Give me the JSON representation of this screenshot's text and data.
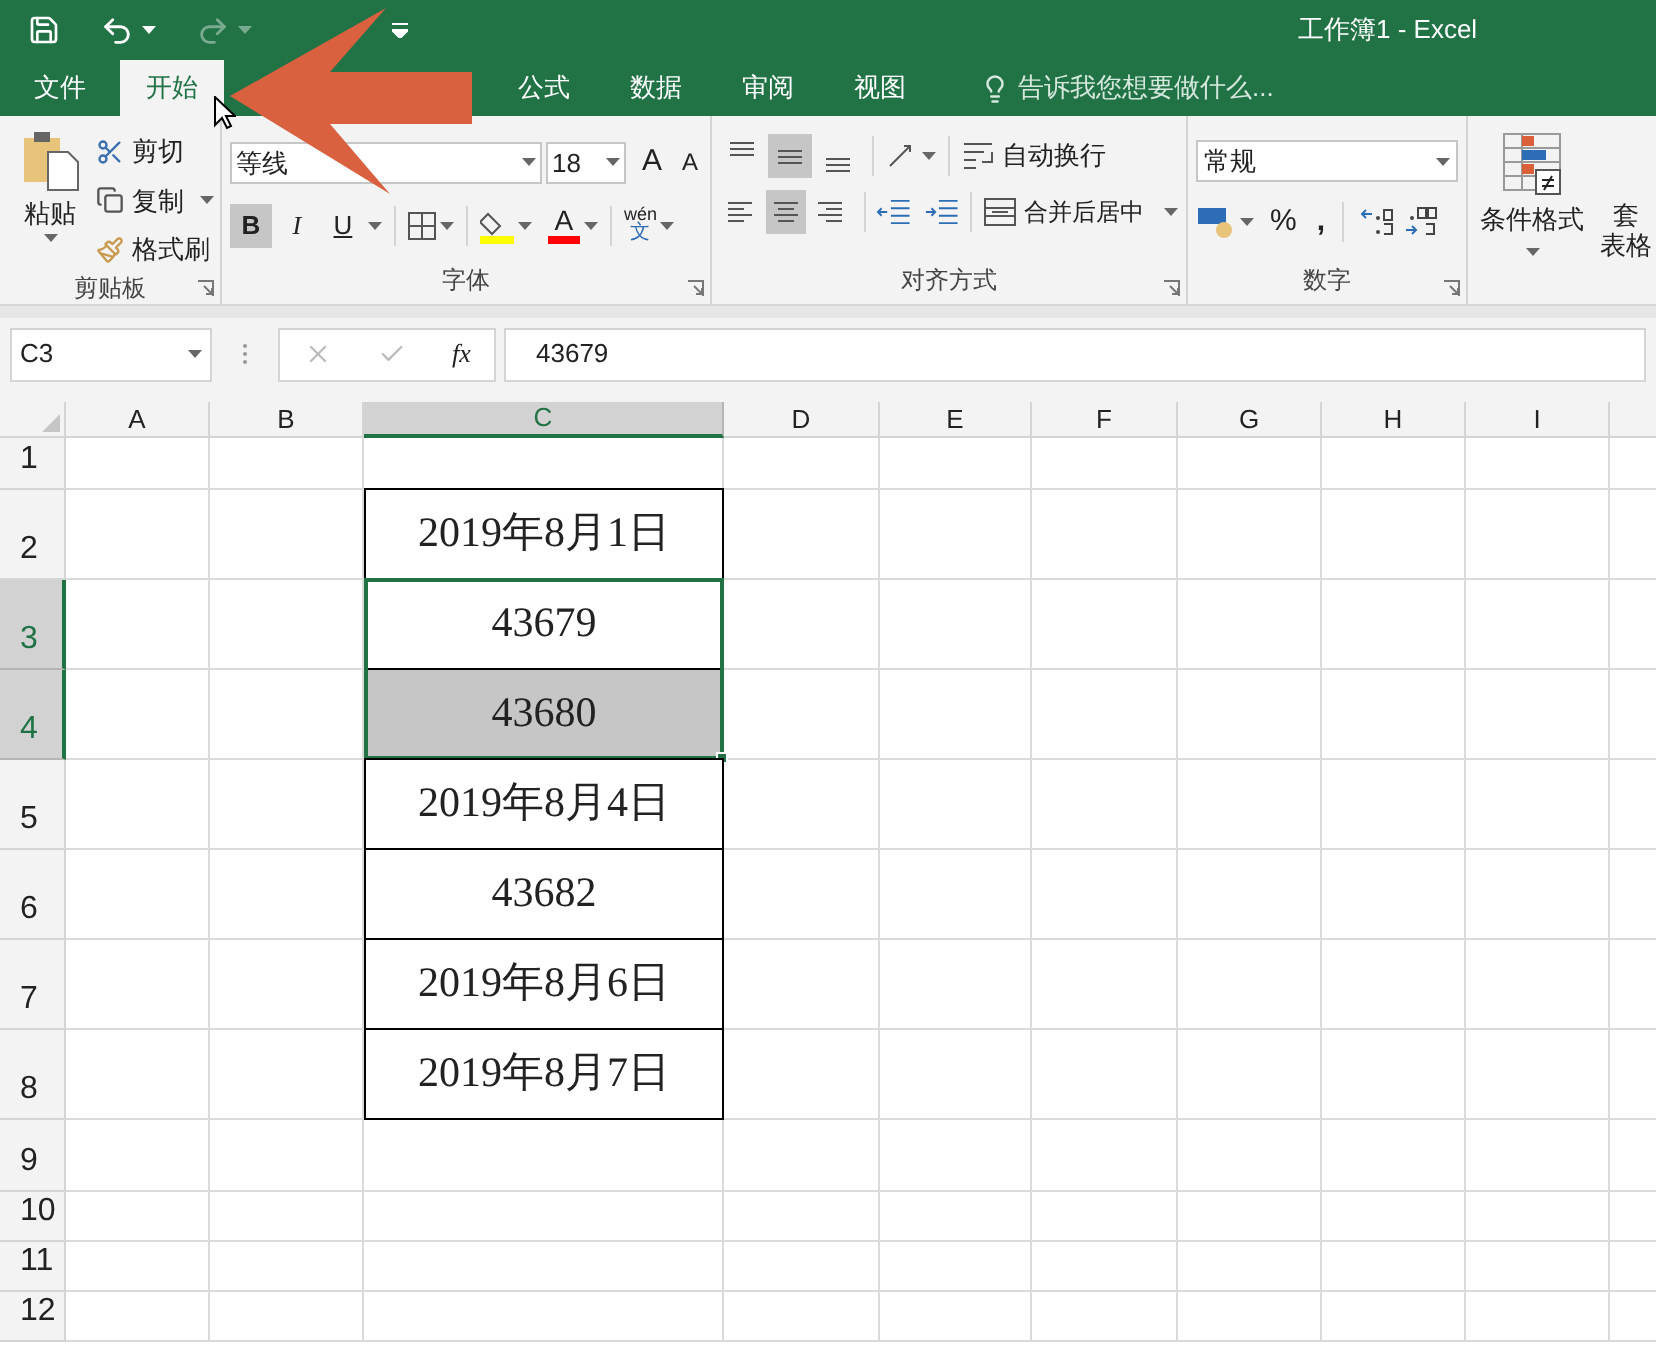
{
  "window": {
    "title": "工作簿1 - Excel"
  },
  "ribbon_tabs": [
    {
      "label": "文件",
      "selected": false
    },
    {
      "label": "开始",
      "selected": true
    },
    {
      "label": "公式",
      "selected": false
    },
    {
      "label": "数据",
      "selected": false
    },
    {
      "label": "审阅",
      "selected": false
    },
    {
      "label": "视图",
      "selected": false
    }
  ],
  "tell_me": {
    "placeholder": "告诉我您想要做什么..."
  },
  "clipboard": {
    "paste": "粘贴",
    "cut": "剪切",
    "copy": "复制",
    "format_painter": "格式刷",
    "group_label": "剪贴板"
  },
  "font": {
    "name": "等线",
    "size": "18",
    "grow": "A",
    "shrink": "A",
    "buttons": [
      {
        "label": "B",
        "selected": true
      },
      {
        "label": "I",
        "selected": false
      },
      {
        "label": "U",
        "selected": false
      }
    ],
    "font_color": "A",
    "phonetic": [
      "wén",
      "文"
    ],
    "group_label": "字体"
  },
  "alignment": {
    "vertical": [
      {
        "kind": "top",
        "selected": false
      },
      {
        "kind": "middle",
        "selected": true
      },
      {
        "kind": "bottom",
        "selected": false
      }
    ],
    "horizontal": [
      {
        "kind": "left",
        "selected": false
      },
      {
        "kind": "center",
        "selected": true
      },
      {
        "kind": "right",
        "selected": false
      }
    ],
    "wrap_text": "自动换行",
    "merge": "合并后居中",
    "group_label": "对齐方式"
  },
  "number": {
    "format": "常规",
    "percent": "%",
    "comma": ",",
    "group_label": "数字"
  },
  "styles": {
    "conditional_format": "条件格式",
    "format_table": [
      "套",
      "表格"
    ]
  },
  "formula_bar": {
    "name_box": "C3",
    "fx": "fx",
    "value": "43679"
  },
  "columns": [
    {
      "label": "A",
      "selected": false
    },
    {
      "label": "B",
      "selected": false
    },
    {
      "label": "C",
      "selected": true
    },
    {
      "label": "D",
      "selected": false
    },
    {
      "label": "E",
      "selected": false
    },
    {
      "label": "F",
      "selected": false
    },
    {
      "label": "G",
      "selected": false
    },
    {
      "label": "H",
      "selected": false
    },
    {
      "label": "I",
      "selected": false
    }
  ],
  "rows": [
    {
      "label": "1",
      "selected": false,
      "c": {
        "bordered": false,
        "selected": false
      }
    },
    {
      "label": "2",
      "selected": false,
      "c": {
        "value": "2019年8月1日",
        "bordered": true,
        "selected": false
      }
    },
    {
      "label": "3",
      "selected": true,
      "c": {
        "value": "43679",
        "bordered": true,
        "selected": true,
        "active": true
      }
    },
    {
      "label": "4",
      "selected": true,
      "c": {
        "value": "43680",
        "bordered": true,
        "selected": true,
        "active": false
      }
    },
    {
      "label": "5",
      "selected": false,
      "c": {
        "value": "2019年8月4日",
        "bordered": true,
        "selected": false
      }
    },
    {
      "label": "6",
      "selected": false,
      "c": {
        "value": "43682",
        "bordered": true,
        "selected": false
      }
    },
    {
      "label": "7",
      "selected": false,
      "c": {
        "value": "2019年8月6日",
        "bordered": true,
        "selected": false
      }
    },
    {
      "label": "8",
      "selected": false,
      "c": {
        "value": "2019年8月7日",
        "bordered": true,
        "selected": false
      }
    },
    {
      "label": "9",
      "selected": false,
      "c": {
        "bordered": false,
        "selected": false
      }
    },
    {
      "label": "10",
      "selected": false,
      "c": {
        "bordered": false,
        "selected": false
      }
    },
    {
      "label": "11",
      "selected": false,
      "c": {
        "bordered": false,
        "selected": false
      }
    },
    {
      "label": "12",
      "selected": false,
      "c": {
        "bordered": false,
        "selected": false
      }
    }
  ]
}
